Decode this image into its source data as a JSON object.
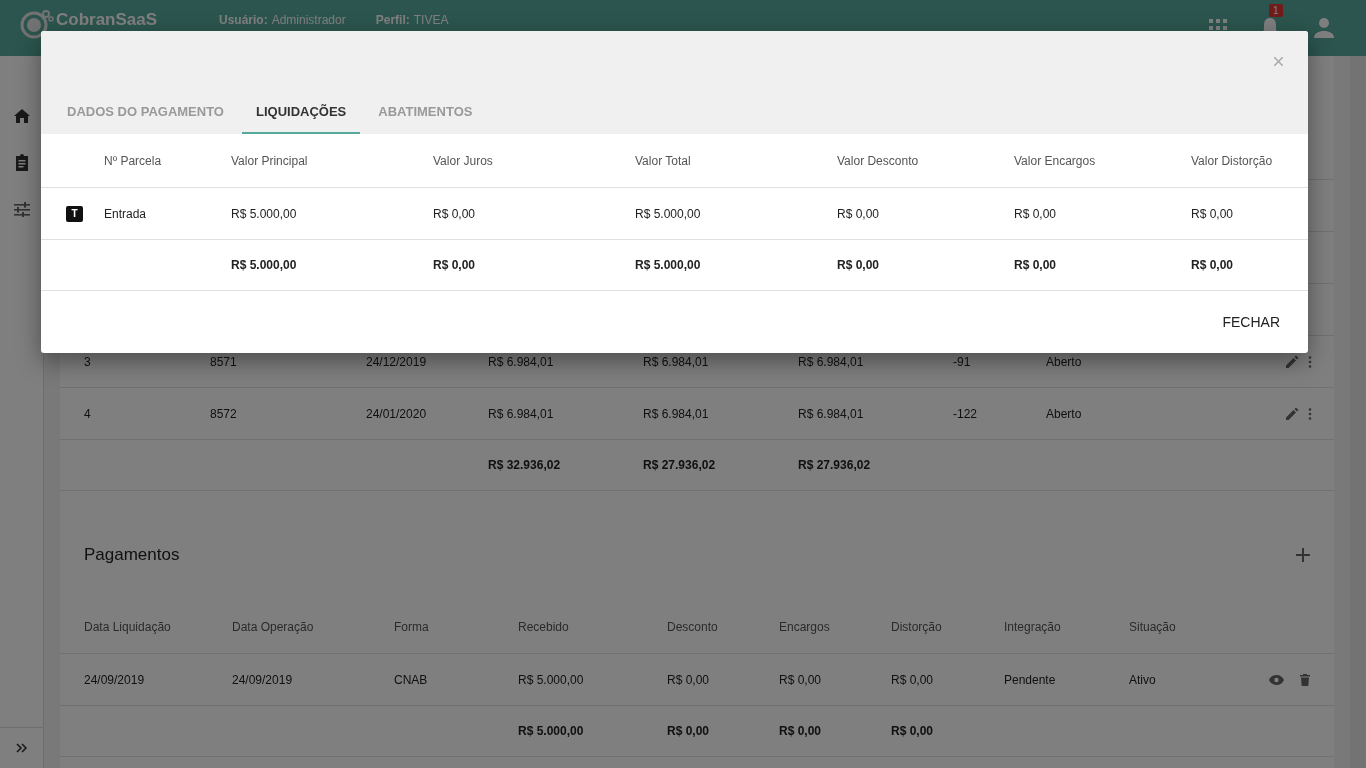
{
  "header": {
    "logo": "CobranSaaS",
    "user_label": "Usuário:",
    "user": "Administrador",
    "profile_label": "Perfil:",
    "profile": "TIVEA",
    "notification_count": "1"
  },
  "installments": {
    "rows": [
      [
        "3",
        "8571",
        "24/12/2019",
        "R$ 6.984,01",
        "R$ 6.984,01",
        "R$ 6.984,01",
        "-91",
        "Aberto"
      ],
      [
        "4",
        "8572",
        "24/01/2020",
        "R$ 6.984,01",
        "R$ 6.984,01",
        "R$ 6.984,01",
        "-122",
        "Aberto"
      ]
    ],
    "totals": [
      "R$ 32.936,02",
      "R$ 27.936,02",
      "R$ 27.936,02"
    ]
  },
  "payments": {
    "title": "Pagamentos",
    "columns": [
      "Data Liquidação",
      "Data Operação",
      "Forma",
      "Recebido",
      "Desconto",
      "Encargos",
      "Distorção",
      "Integração",
      "Situação"
    ],
    "rows": [
      [
        "24/09/2019",
        "24/09/2019",
        "CNAB",
        "R$ 5.000,00",
        "R$ 0,00",
        "R$ 0,00",
        "R$ 0,00",
        "Pendente",
        "Ativo"
      ]
    ],
    "totals": [
      "R$ 5.000,00",
      "R$ 0,00",
      "R$ 0,00",
      "R$ 0,00"
    ]
  },
  "dialog": {
    "tabs": [
      {
        "label": "DADOS DO PAGAMENTO",
        "selected": false
      },
      {
        "label": "LIQUIDAÇÕES",
        "selected": true
      },
      {
        "label": "ABATIMENTOS",
        "selected": false
      }
    ],
    "columns": [
      "Nº Parcela",
      "Valor Principal",
      "Valor Juros",
      "Valor Total",
      "Valor Desconto",
      "Valor Encargos",
      "Valor Distorção"
    ],
    "rows": [
      {
        "tag": "T",
        "cells": [
          "Entrada",
          "R$ 5.000,00",
          "R$ 0,00",
          "R$ 5.000,00",
          "R$ 0,00",
          "R$ 0,00",
          "R$ 0,00"
        ]
      }
    ],
    "totals": [
      "R$ 5.000,00",
      "R$ 0,00",
      "R$ 5.000,00",
      "R$ 0,00",
      "R$ 0,00",
      "R$ 0,00"
    ],
    "close_button": "FECHAR"
  }
}
